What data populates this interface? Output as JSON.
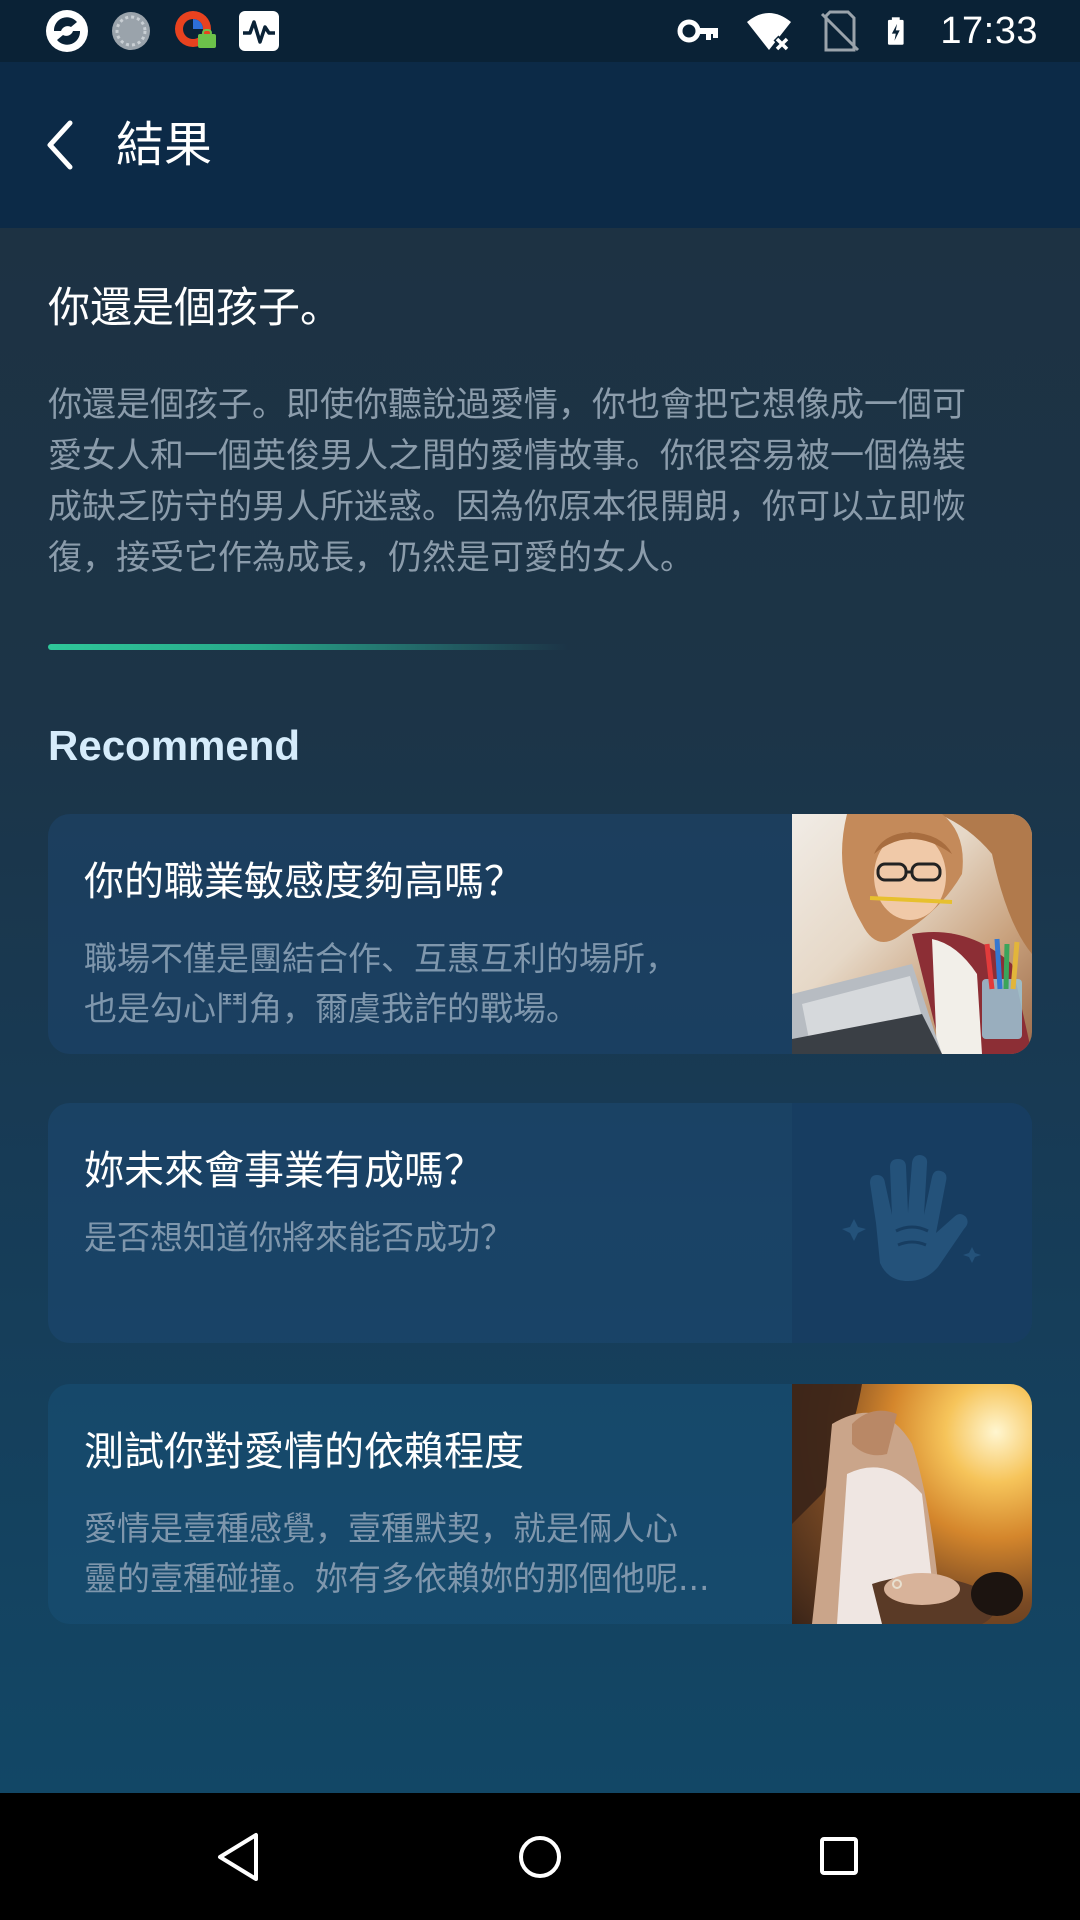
{
  "status_bar": {
    "time": "17:33",
    "left_icons": [
      "app-logo-icon",
      "loading-icon",
      "vpn-app-icon",
      "activity-monitor-icon"
    ],
    "right_icons": [
      "vpn-key-icon",
      "wifi-icon",
      "no-sim-icon",
      "battery-charging-icon"
    ]
  },
  "header": {
    "title": "結果",
    "back_icon": "chevron-left-icon"
  },
  "result": {
    "title": "你還是個孩子。",
    "lines": [
      "你還是個孩子。即使你聽說過愛情，你也會把它想像成一個可",
      "愛女人和一個英俊男人之間的愛情故事。你很容易被一個偽裝",
      "成缺乏防守的男人所迷惑。因為你原本很開朗，你可以立即恢",
      "復，接受它作為成長，仍然是可愛的女人。"
    ]
  },
  "recommend": {
    "heading": "Recommend",
    "cards": [
      {
        "title": "你的職業敏感度夠高嗎？",
        "desc_lines": [
          "職場不僅是團結合作、互惠互利的場所，",
          "也是勾心鬥角，爾虞我詐的戰場。"
        ],
        "thumb": "woman-at-laptop-photo"
      },
      {
        "title": "妳未來會事業有成嗎？",
        "desc_lines": [
          "是否想知道你將來能否成功？"
        ],
        "thumb": "palm-hand-icon"
      },
      {
        "title": "測試你對愛情的依賴程度",
        "desc_lines": [
          "愛情是壹種感覺，壹種默契，就是倆人心",
          "靈的壹種碰撞。妳有多依賴妳的那個他呢..."
        ],
        "thumb": "woman-in-sunset-photo"
      }
    ]
  },
  "nav_bar": {
    "icons": [
      "nav-back-icon",
      "nav-home-icon",
      "nav-recents-icon"
    ]
  },
  "colors": {
    "header_bg": "#0c2a47",
    "accent_divider": "#2fc89a",
    "recommend_heading": "#d6ecfb",
    "body_text": "#8b9cab"
  }
}
